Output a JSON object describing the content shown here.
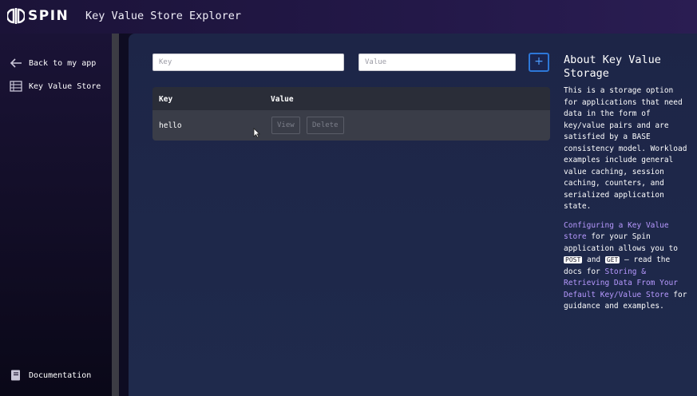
{
  "header": {
    "logo_text": "SPIN",
    "title": "Key Value Store Explorer"
  },
  "sidebar": {
    "items": [
      {
        "label": "Back to my app",
        "icon": "arrow-left-icon"
      },
      {
        "label": "Key Value Store",
        "icon": "table-icon"
      }
    ],
    "footer": {
      "label": "Documentation",
      "icon": "book-icon"
    }
  },
  "form": {
    "key_placeholder": "Key",
    "value_placeholder": "Value",
    "add_label": "+"
  },
  "table": {
    "columns": [
      "Key",
      "Value"
    ],
    "rows": [
      {
        "key": "hello",
        "view_label": "View",
        "delete_label": "Delete"
      }
    ]
  },
  "about": {
    "heading": "About Key Value Storage",
    "paragraph1": "This is a storage option for applications that need data in the form of key/value pairs and are satisfied by a BASE consistency model. Workload examples include general value caching, session caching, counters, and serialized application state.",
    "p2_link1": "Configuring a Key Value store",
    "p2_text1": " for your Spin application allows you to ",
    "p2_code1": "POST",
    "p2_text2": " and ",
    "p2_code2": "GET",
    "p2_text3": " — read the docs for ",
    "p2_link2": "Storing & Retrieving Data From Your Default Key/Value Store",
    "p2_text4": " for guidance and examples."
  },
  "colors": {
    "accent": "#2d77d8",
    "link": "#b799ff",
    "main_bg": "#1f2a4c"
  }
}
